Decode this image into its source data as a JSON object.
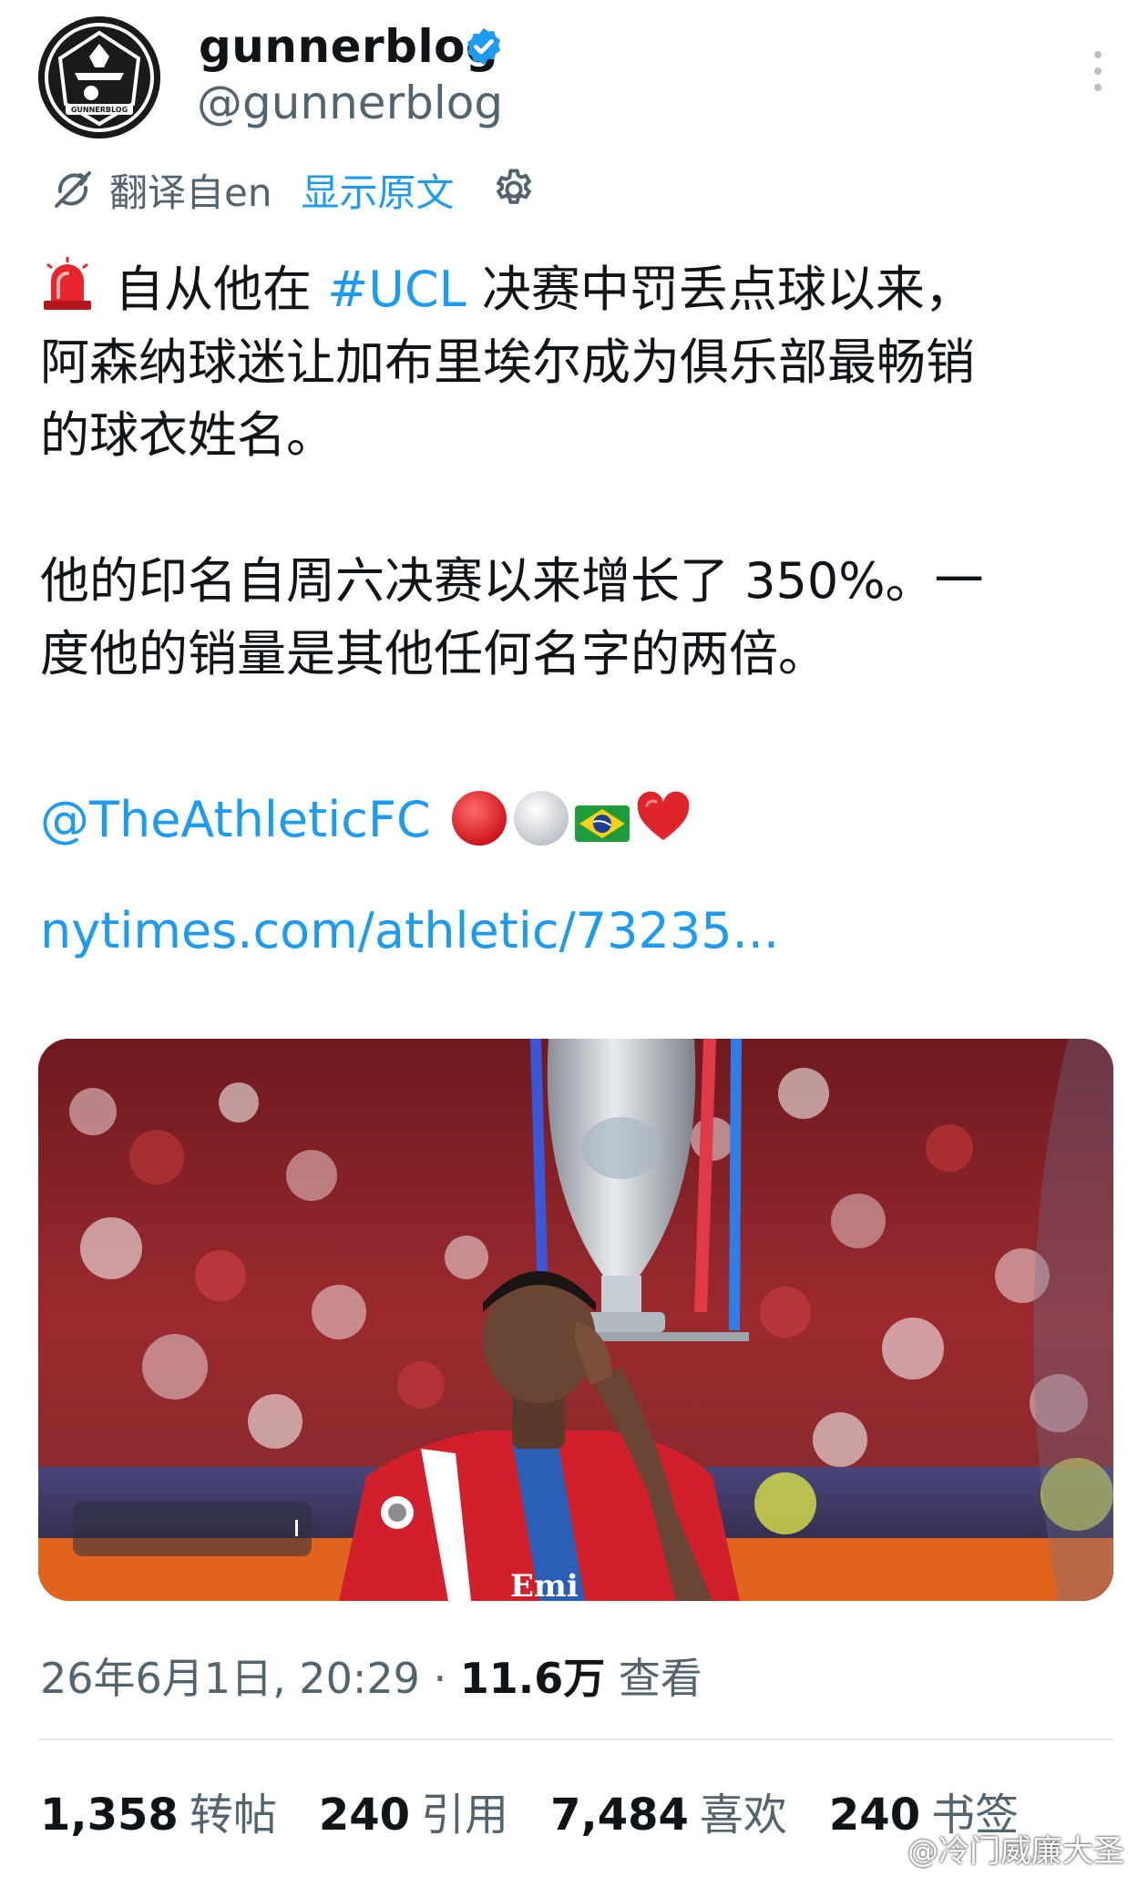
{
  "author": {
    "display_name": "gunnerblog",
    "handle": "@gunnerblog",
    "avatar_text": "GUNNERBLOG",
    "verified_icon": "verified-badge-icon"
  },
  "translation": {
    "translated_from": "翻译自en",
    "show_original": "显示原文"
  },
  "tweet": {
    "line1_before": "自从他在 ",
    "hashtag": "#UCL",
    "line1_after": " 决赛中罚丢点球以来，",
    "line2": "阿森纳球迷让加布里埃尔成为俱乐部最畅销",
    "line3": "的球衣姓名。",
    "line4": "他的印名自周六决赛以来增长了 350%。一",
    "line5": "度他的销量是其他任何名字的两倍。",
    "mention": "@TheAthleticFC",
    "url": "nytimes.com/athletic/73235..."
  },
  "media": {
    "jersey_text": "Emi"
  },
  "meta": {
    "date": "26年6月1日, 20:29 · ",
    "views_count": "11.6万",
    "views_label": " 查看"
  },
  "stats": [
    {
      "num": "1,358",
      "label": "转帖"
    },
    {
      "num": "240",
      "label": "引用"
    },
    {
      "num": "7,484",
      "label": "喜欢"
    },
    {
      "num": "240",
      "label": "书签"
    }
  ],
  "watermark": "@冷门威廉大圣",
  "colors": {
    "link": "#1d9bf0",
    "secondary_text": "#536471",
    "primary_text": "#0f1419",
    "arsenal_red": "#d0202b"
  }
}
